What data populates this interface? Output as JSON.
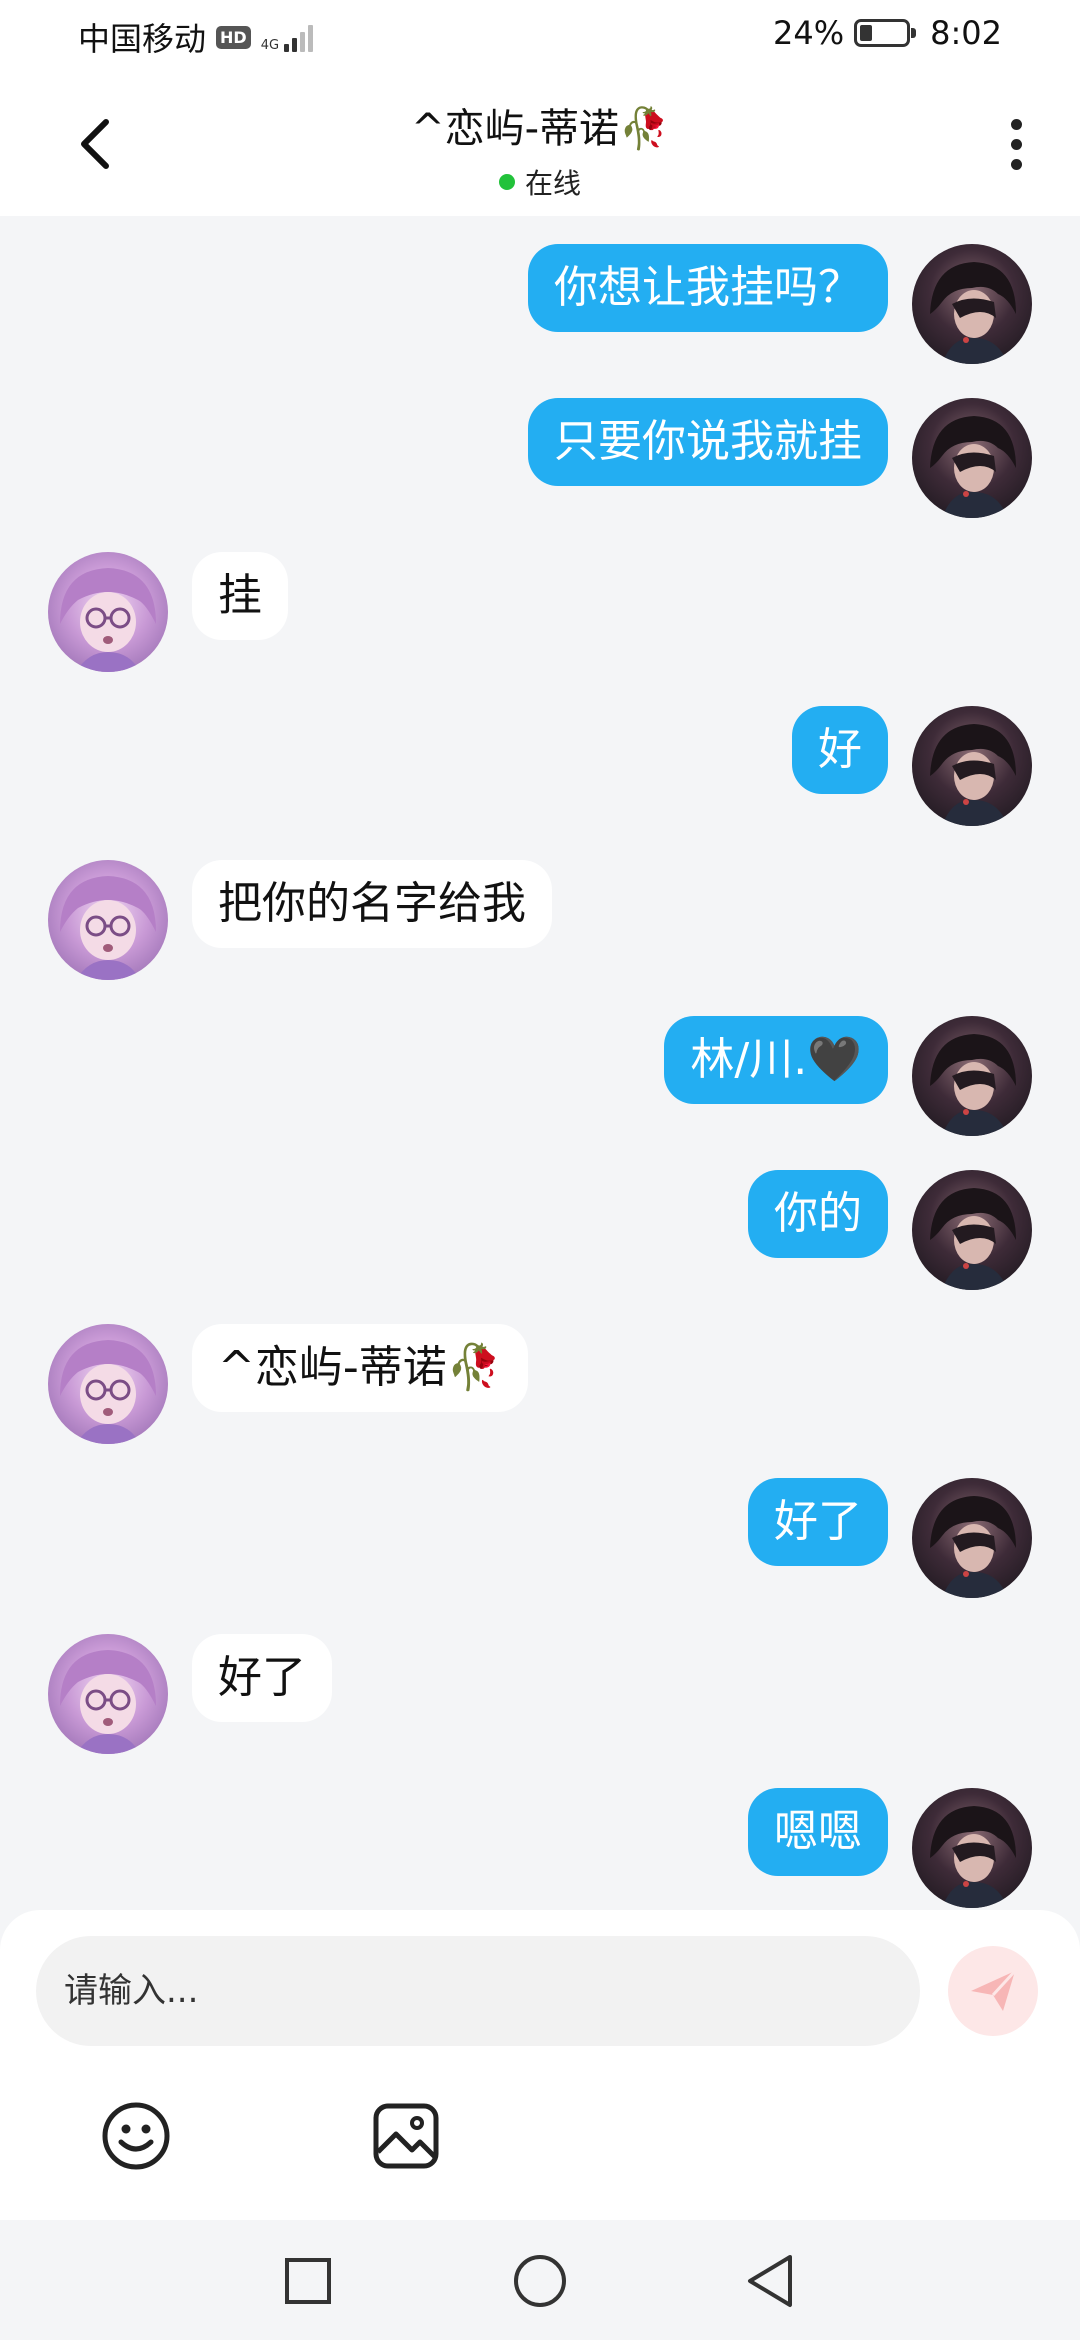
{
  "status_bar": {
    "carrier": "中国移动",
    "hd": "HD",
    "network": "4G",
    "battery": "24%",
    "battery_level": 0.24,
    "time": "8:02"
  },
  "header": {
    "title": "^恋屿-蒂诺🥀",
    "status": "在线"
  },
  "messages": [
    {
      "from": "me",
      "text": "你想让我挂吗？"
    },
    {
      "from": "me",
      "text": "只要你说我就挂"
    },
    {
      "from": "other",
      "text": "挂"
    },
    {
      "from": "me",
      "text": "好"
    },
    {
      "from": "other",
      "text": "把你的名字给我"
    },
    {
      "from": "me",
      "text": "林/川.🖤"
    },
    {
      "from": "me",
      "text": "你的"
    },
    {
      "from": "other",
      "text": "^恋屿-蒂诺🥀"
    },
    {
      "from": "me",
      "text": "好了"
    },
    {
      "from": "other",
      "text": "好了"
    },
    {
      "from": "me",
      "text": "嗯嗯"
    }
  ],
  "composer": {
    "placeholder": "请输入...",
    "send_icon": "paper-plane-icon",
    "emoji_icon": "emoji-icon",
    "image_icon": "image-icon"
  },
  "navbar": {
    "icons": [
      "recent-apps-icon",
      "home-icon",
      "back-triangle-icon"
    ]
  },
  "colors": {
    "accent": "#23aef2",
    "online": "#22c23a",
    "send_disabled": "#fde7e7"
  }
}
